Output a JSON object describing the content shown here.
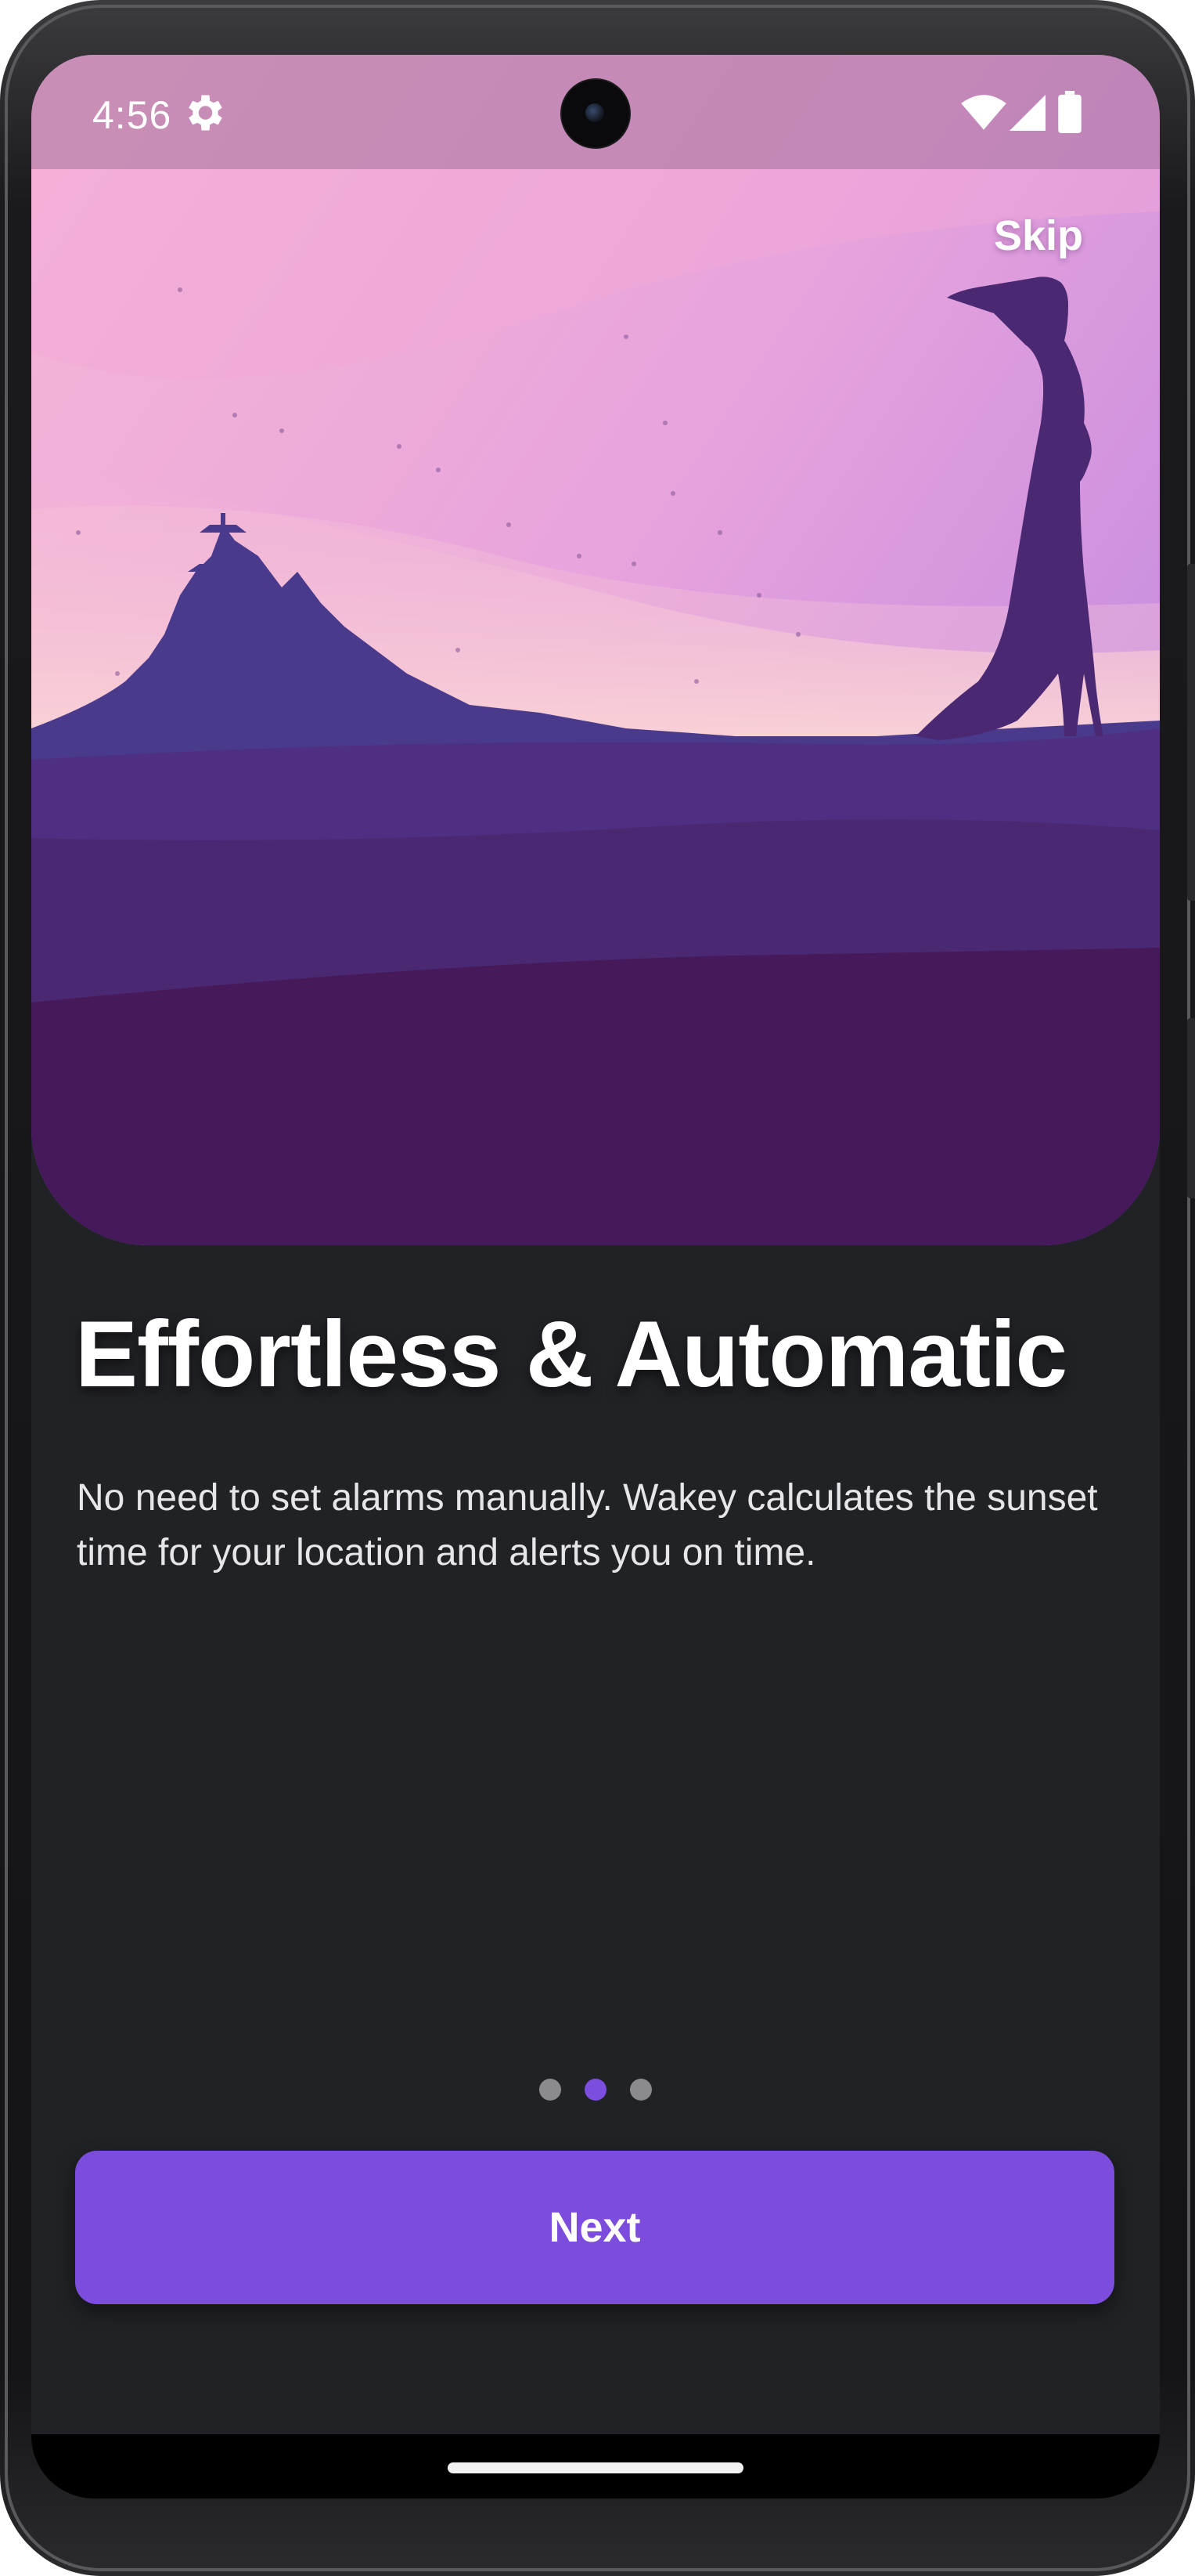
{
  "status_bar": {
    "time": "4:56",
    "icons": [
      "gear-icon",
      "wifi-icon",
      "signal-icon",
      "battery-icon"
    ]
  },
  "onboarding": {
    "skip_label": "Skip",
    "title": "Effortless & Automatic",
    "description": "No need to set alarms manually. Wakey calculates the sunset time for your location and alerts you on time.",
    "page_count": 3,
    "current_page": 2,
    "next_label": "Next"
  },
  "colors": {
    "background": "#212226",
    "accent": "#7c4ddd",
    "indicator_active": "#7c4ee0",
    "indicator_inactive": "#8a8a8f",
    "hero_sky_top": "#f3b0d8",
    "hero_ground": "#4a1a58"
  }
}
